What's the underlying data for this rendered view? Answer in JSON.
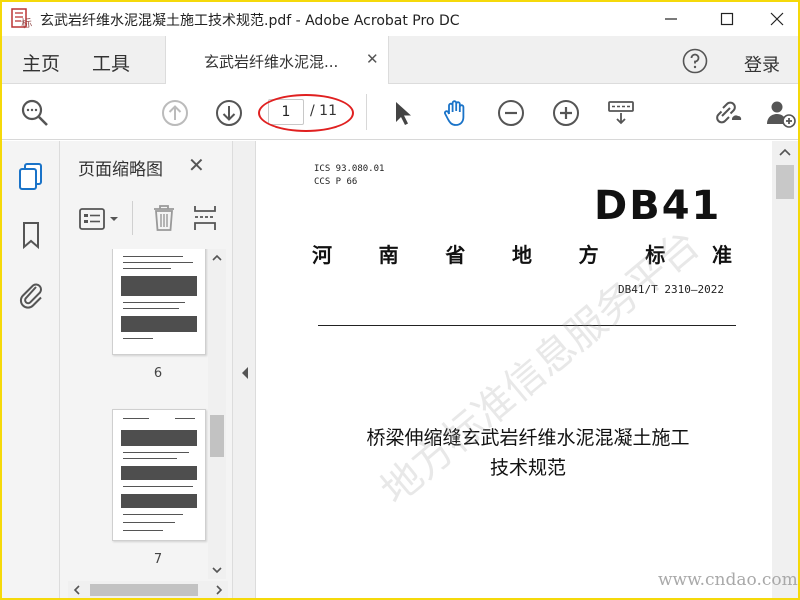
{
  "window": {
    "title": "玄武岩纤维水泥混凝土施工技术规范.pdf - Adobe Acrobat Pro DC",
    "logo_text": "标"
  },
  "tabs": {
    "home": "主页",
    "tools": "工具",
    "document": "玄武岩纤维水泥混...",
    "login": "登录"
  },
  "toolbar": {
    "page_current": "1",
    "page_total": "/ 11"
  },
  "thumbnails": {
    "title": "页面缩略图",
    "pages": [
      {
        "number": "6"
      },
      {
        "number": "7"
      }
    ]
  },
  "document": {
    "ics": "ICS  93.080.01",
    "ccs": "CCS  P  66",
    "logo": "DB41",
    "standard_chars": [
      "河",
      "南",
      "省",
      "地",
      "方",
      "标",
      "准"
    ],
    "code": "DB41/T  2310—2022",
    "title_line1": "桥梁伸缩缝玄武岩纤维水泥混凝土施工",
    "title_line2": "技术规范",
    "watermark": "地方标准信息服务平台"
  },
  "site_watermark": "www.cndao.com",
  "colors": {
    "accent_blue": "#1a73c8",
    "annotation_red": "#e02020",
    "frame_yellow": "#f5d90a"
  }
}
